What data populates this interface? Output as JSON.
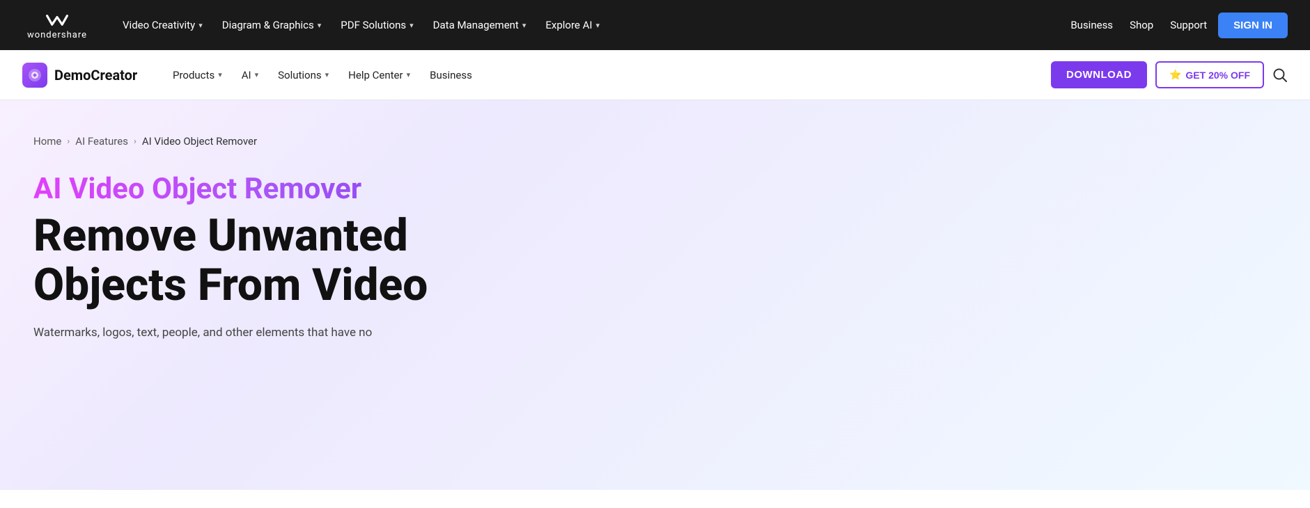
{
  "top_nav": {
    "logo": {
      "icon_text": "W",
      "text": "wondershare"
    },
    "links": [
      {
        "label": "Video Creativity",
        "has_chevron": true
      },
      {
        "label": "Diagram & Graphics",
        "has_chevron": true
      },
      {
        "label": "PDF Solutions",
        "has_chevron": true
      },
      {
        "label": "Data Management",
        "has_chevron": true
      },
      {
        "label": "Explore AI",
        "has_chevron": true
      }
    ],
    "right_links": [
      {
        "label": "Business"
      },
      {
        "label": "Shop"
      },
      {
        "label": "Support"
      }
    ],
    "sign_in_label": "SIGN IN"
  },
  "second_nav": {
    "product_name": "DemoCreator",
    "links": [
      {
        "label": "Products",
        "has_chevron": true
      },
      {
        "label": "AI",
        "has_chevron": true
      },
      {
        "label": "Solutions",
        "has_chevron": true
      },
      {
        "label": "Help Center",
        "has_chevron": true
      },
      {
        "label": "Business",
        "has_chevron": false
      }
    ],
    "download_label": "DOWNLOAD",
    "discount_label": "GET 20% OFF",
    "discount_icon": "★",
    "search_placeholder": "Search"
  },
  "breadcrumb": {
    "items": [
      {
        "label": "Home",
        "is_link": true
      },
      {
        "label": "AI Features",
        "is_link": true
      },
      {
        "label": "AI Video Object Remover",
        "is_link": false
      }
    ]
  },
  "hero": {
    "subtitle": "AI Video Object Remover",
    "title_line1": "Remove Unwanted",
    "title_line2": "Objects From Video",
    "description": "Watermarks, logos, text, people, and other elements that have no"
  }
}
